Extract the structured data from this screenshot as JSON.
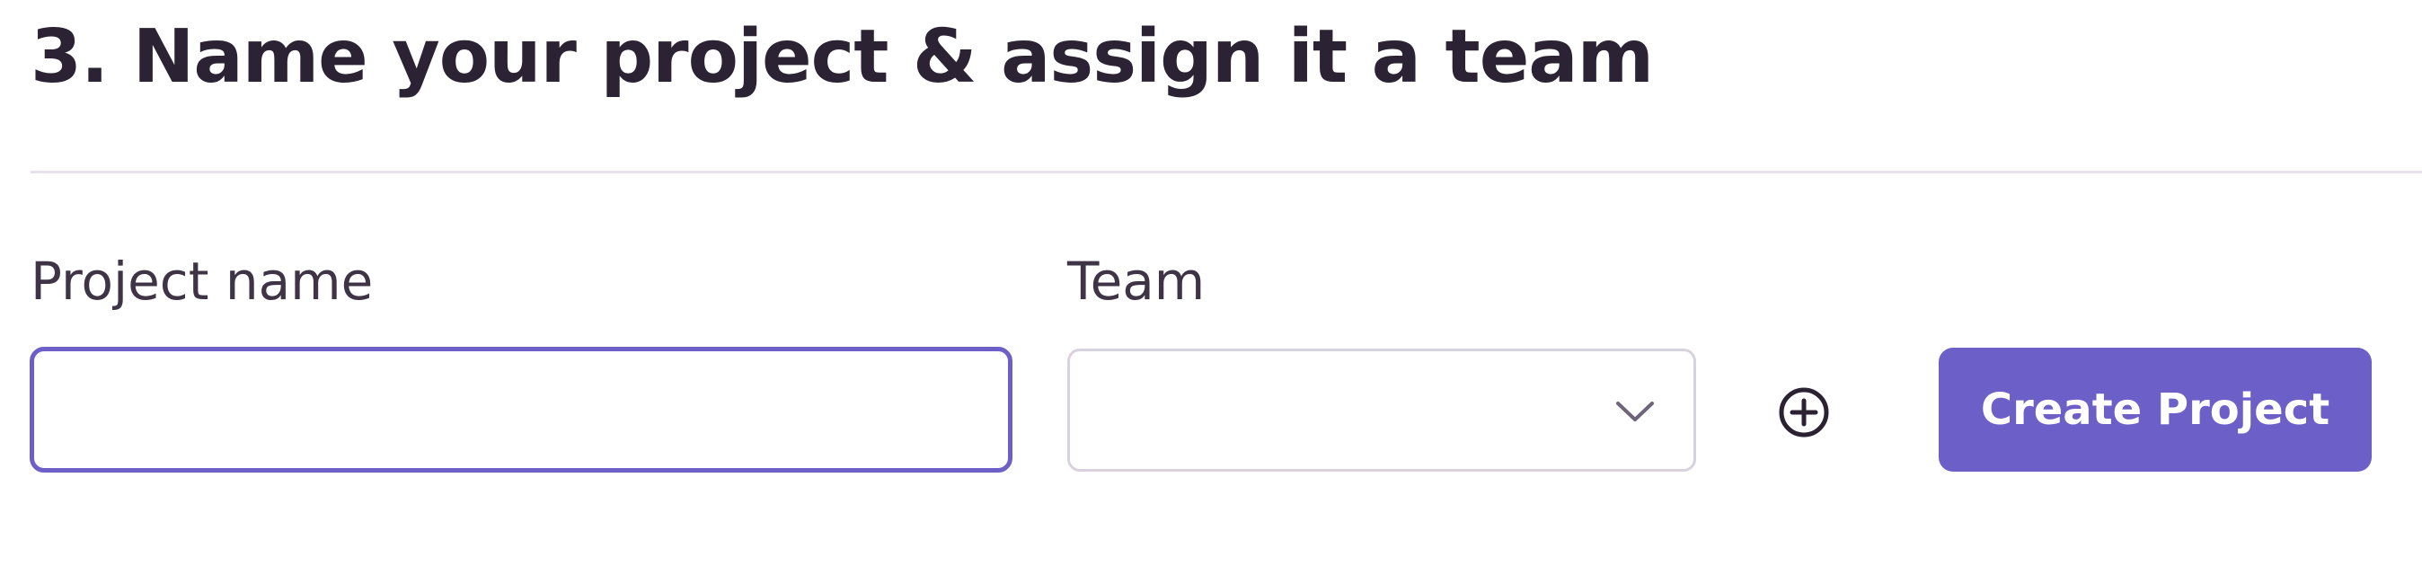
{
  "section": {
    "title": "3. Name your project & assign it a team"
  },
  "form": {
    "project_name": {
      "label": "Project name",
      "value": "",
      "placeholder": ""
    },
    "team": {
      "label": "Team",
      "selected_value": "",
      "dropdown_icon": "chevron-down-icon"
    },
    "add_team": {
      "icon": "plus-circle-icon"
    },
    "create_button": {
      "label": "Create Project"
    }
  },
  "colors": {
    "accent": "#6c5fc7",
    "text": "#2b2233",
    "border": "#d8d2de",
    "divider": "#e7e1ec"
  }
}
